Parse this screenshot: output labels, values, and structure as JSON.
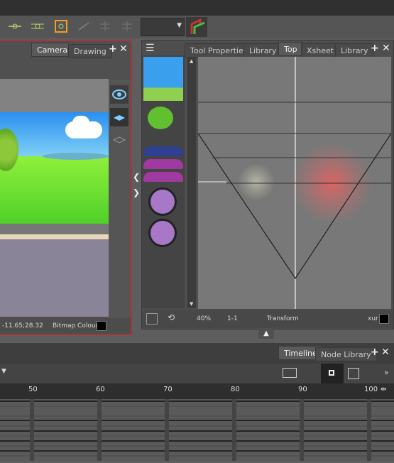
{
  "left_panel": {
    "tabs": [
      {
        "label": "Camera",
        "active": true
      },
      {
        "label": "Drawing",
        "active": false
      }
    ],
    "coords": "-11.65;28.32",
    "bitmap_label": "Bitmap Colour"
  },
  "right_panel": {
    "tabs": [
      {
        "label": "Tool Properties",
        "active": false
      },
      {
        "label": "Library",
        "active": false
      },
      {
        "label": "Top",
        "active": true
      },
      {
        "label": "Xsheet",
        "active": false
      },
      {
        "label": "Library",
        "active": false
      }
    ],
    "zoom": "40%",
    "frame": "1-1",
    "tool": "Transform",
    "tool_right": "xur"
  },
  "timeline": {
    "tabs": [
      {
        "label": "Timeline",
        "active": true
      },
      {
        "label": "Node Library",
        "active": false
      }
    ],
    "ruler_labels": [
      "50",
      "60",
      "70",
      "80",
      "90",
      "100"
    ]
  },
  "colors": {
    "accent_red": "#a33333",
    "grass": "#5fd42e",
    "sky": "#36a0f0"
  }
}
